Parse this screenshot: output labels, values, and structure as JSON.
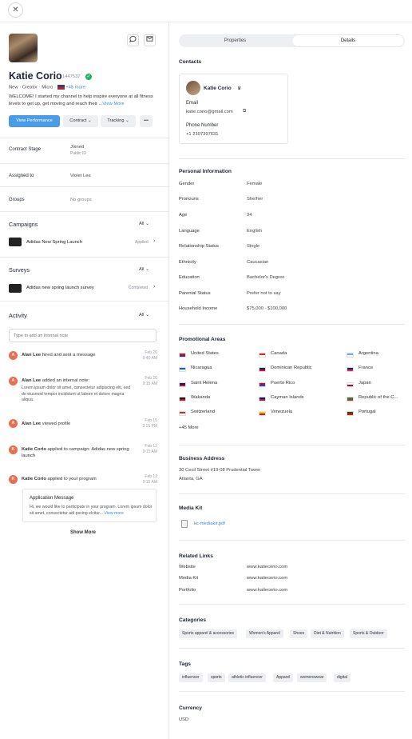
{
  "profile": {
    "name": "Katie Corio",
    "id": "1447537",
    "meta": "New · Creator · Micro ·",
    "more_locations": "+45 more",
    "bio": "WELCOME! I started my channel to help inspire everyone at all fitness levels to get up, get moving and reach their ...",
    "bio_more": "View More",
    "view_performance": "View Performance",
    "contract": "Contract",
    "tracking": "Tracking",
    "more": "•••"
  },
  "fields": {
    "contract_stage_label": "Contract Stage",
    "contract_stage_value": "Joined",
    "contract_stage_sub": "Public ID",
    "assigned_label": "Assigned to",
    "assigned_value": "Violet Lee",
    "groups_label": "Groups",
    "groups_value": "No groups"
  },
  "campaigns": {
    "title": "Campaigns",
    "filter": "All",
    "item": "Adidas New Spring Launch",
    "status": "Applied"
  },
  "surveys": {
    "title": "Surveys",
    "filter": "All",
    "item": "Adidas new spring launch survey",
    "status": "Completed"
  },
  "activity": {
    "title": "Activity",
    "filter": "All",
    "placeholder": "Type to add an internal note",
    "items": [
      {
        "avatar": "A",
        "actor": "Alan Lee",
        "text": " hired and sent a message",
        "date": "Feb 26",
        "time": "9:40 AM"
      },
      {
        "avatar": "A",
        "actor": "Alan Lee",
        "text": " added an internal note:",
        "note": "Lorem ipsum dolor sit amet, consectetur adipiscing elit, sed do eiusmod tempor incididunt ut labore et dolore magna aliqua.",
        "date": "Feb 26",
        "time": "9:15 AM"
      },
      {
        "avatar": "A",
        "actor": "Alan Lee",
        "text": " viewed profile",
        "date": "Feb 15",
        "time": "3:15 PM"
      },
      {
        "avatar": "K",
        "actor": "Katie Corio",
        "text": " applied to campaign: Adidas new spring launch",
        "date": "Feb 12",
        "time": "9:15 AM"
      },
      {
        "avatar": "K",
        "actor": "Katie Corio",
        "text": " applied to your program",
        "date": "Feb 12",
        "time": "9:15 AM"
      }
    ],
    "application_title": "Application Message",
    "application_text": "Hi, we would like to participate in your program. Lorem ipsum dolor sit amet, consectetur adi pscing elcitur... ",
    "application_more": "View more",
    "show_more": "Show More"
  },
  "tabs": {
    "properties": "Properties",
    "details": "Details"
  },
  "contacts": {
    "title": "Contacts",
    "name": "Katie Corio",
    "email_label": "Email",
    "email": "katie.corio@gmail.com",
    "phone_label": "Phone Number",
    "phone": "+1 2107397631"
  },
  "personal": {
    "title": "Personal Information",
    "rows": [
      {
        "label": "Gender",
        "value": "Female"
      },
      {
        "label": "Pronouns",
        "value": "She/her"
      },
      {
        "label": "Age",
        "value": "34"
      },
      {
        "label": "Language",
        "value": "English"
      },
      {
        "label": "Relationship Status",
        "value": "Single"
      },
      {
        "label": "Ethnicity",
        "value": "Caucasian"
      },
      {
        "label": "Education",
        "value": "Bachelor's Degree"
      },
      {
        "label": "Parental Status",
        "value": "Prefer not to say"
      },
      {
        "label": "Household Income",
        "value": "$75,000 - $100,000"
      }
    ]
  },
  "promo": {
    "title": "Promotional Areas",
    "countries": [
      {
        "name": "United States",
        "c1": "#b22234",
        "c2": "#3c3b6e"
      },
      {
        "name": "Canada",
        "c1": "#d52b1e",
        "c2": "#ffffff"
      },
      {
        "name": "Argentina",
        "c1": "#74acdf",
        "c2": "#ffffff"
      },
      {
        "name": "Nicaragua",
        "c1": "#0067c6",
        "c2": "#ffffff"
      },
      {
        "name": "Dominican Republic",
        "c1": "#002d62",
        "c2": "#ce1126"
      },
      {
        "name": "France",
        "c1": "#002395",
        "c2": "#ed2939"
      },
      {
        "name": "Saint Helena",
        "c1": "#012169",
        "c2": "#c8102e"
      },
      {
        "name": "Puerto Rico",
        "c1": "#ed0000",
        "c2": "#0050f0"
      },
      {
        "name": "Japan",
        "c1": "#ffffff",
        "c2": "#bc002d"
      },
      {
        "name": "Wakanda",
        "c1": "#1b1b1b",
        "c2": "#c8102e"
      },
      {
        "name": "Cayman Islands",
        "c1": "#012169",
        "c2": "#c8102e"
      },
      {
        "name": "Republic of the C...",
        "c1": "#009543",
        "c2": "#dc241f"
      },
      {
        "name": "Switzerland",
        "c1": "#da291c",
        "c2": "#ffffff"
      },
      {
        "name": "Venezuela",
        "c1": "#ffcc00",
        "c2": "#cf142b"
      },
      {
        "name": "Portugal",
        "c1": "#006600",
        "c2": "#ff0000"
      }
    ],
    "more": "+45 More"
  },
  "address": {
    "title": "Business Address",
    "line1": "30 Cecil Street #19-08 Prudential Tower",
    "line2": "Atlanta, GA"
  },
  "mediakit": {
    "title": "Media Kit",
    "file": "kc-mediakit.pdf"
  },
  "links": {
    "title": "Related Links",
    "rows": [
      {
        "label": "Website",
        "value": "www.katiecorio.com"
      },
      {
        "label": "Media Kit",
        "value": "www.katiecorio.com"
      },
      {
        "label": "Portfolio",
        "value": "www.katiecorio.com"
      }
    ]
  },
  "categories": {
    "title": "Categories",
    "items": [
      "Sports apparel & accessories",
      "Women's Apparel",
      "Shoes",
      "Diet & Nutrition",
      "Sports & Outdoor"
    ]
  },
  "tags": {
    "title": "Tags",
    "items": [
      "influencer",
      "sports",
      "athletic influencer",
      "Apparel",
      "womenswear",
      "digital"
    ]
  },
  "currency": {
    "title": "Currency",
    "value": "USD"
  },
  "colors": {
    "accent": "#4a9be8",
    "link": "#2e8ce6",
    "avatar": "#ec6c4e"
  }
}
